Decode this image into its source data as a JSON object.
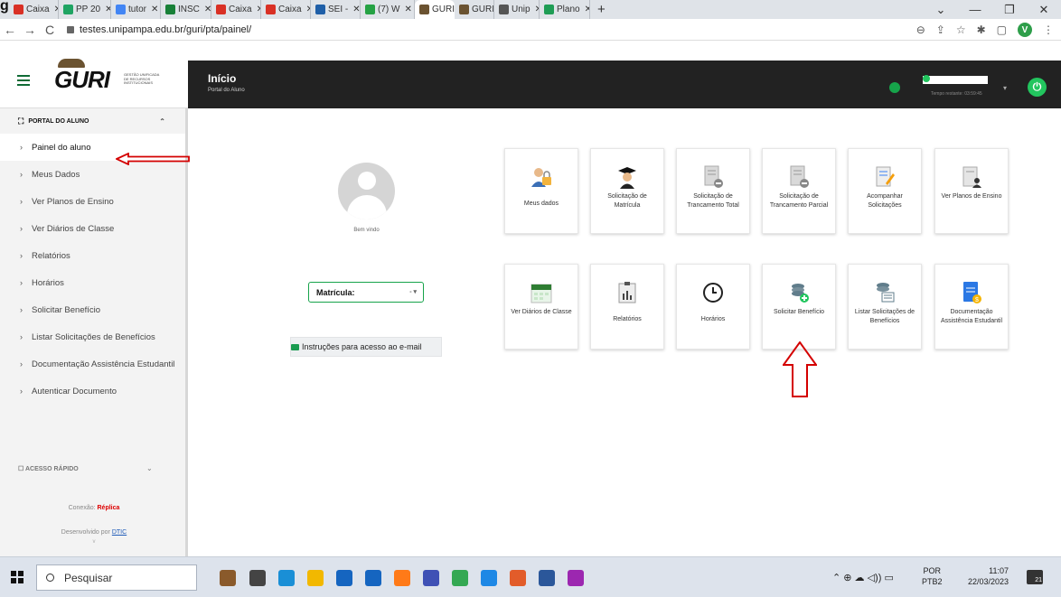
{
  "browser": {
    "tabs": [
      {
        "label": "Caixa",
        "icon": "gmail-icon",
        "color": "#d93025"
      },
      {
        "label": "PP 20",
        "icon": "drive-icon",
        "color": "#1fa463"
      },
      {
        "label": "tutor",
        "icon": "docs-icon",
        "color": "#4285f4"
      },
      {
        "label": "INSC",
        "icon": "sheets-icon",
        "color": "#188038"
      },
      {
        "label": "Caixa",
        "icon": "gmail-icon",
        "color": "#d93025"
      },
      {
        "label": "Caixa",
        "icon": "gmail-icon",
        "color": "#d93025"
      },
      {
        "label": "SEI -",
        "icon": "sei-icon",
        "color": "#1f5fa8"
      },
      {
        "label": "(7) W",
        "icon": "whatsapp-icon",
        "color": "#25a244"
      },
      {
        "label": "GURI",
        "icon": "guri-icon",
        "color": "#6b5331"
      },
      {
        "label": "GURI",
        "icon": "guri-icon",
        "color": "#6b5331"
      },
      {
        "label": "Unip",
        "icon": "globe-icon",
        "color": "#555555"
      },
      {
        "label": "Plano",
        "icon": "plano-icon",
        "color": "#1f9d55"
      }
    ],
    "active_tab": 8,
    "url": "testes.unipampa.edu.br/guri/pta/painel/",
    "profile_initial": "V"
  },
  "header": {
    "title": "Início",
    "subtitle": "Portal do Aluno",
    "timer": "Tempo restante: 03:59:45"
  },
  "logo": {
    "text": "GURI",
    "subtitle": "GESTÃO UNIFICADA DE RECURSOS INSTITUCIONAIS"
  },
  "sidebar": {
    "section_title": "PORTAL DO ALUNO",
    "items": [
      {
        "label": "Painel do aluno",
        "active": true
      },
      {
        "label": "Meus Dados"
      },
      {
        "label": "Ver Planos de Ensino"
      },
      {
        "label": "Ver Diários de Classe"
      },
      {
        "label": "Relatórios"
      },
      {
        "label": "Horários"
      },
      {
        "label": "Solicitar Benefício"
      },
      {
        "label": "Listar Solicitações de Benefícios"
      },
      {
        "label": "Documentação Assistência Estudantil"
      },
      {
        "label": "Autenticar Documento"
      }
    ],
    "quick_access": "ACESSO RÁPIDO",
    "connection_label": "Conexão:",
    "connection_value": "Réplica",
    "developed_by": "Desenvolvido por",
    "developer": "DTIC",
    "version": "v"
  },
  "main": {
    "welcome": "Bem vindo",
    "matricula_label": "Matrícula:",
    "email_button": "Instruções para acesso ao e-mail",
    "cards_row1": [
      {
        "label": "Meus dados",
        "icon": "user-lock-icon"
      },
      {
        "label": "Solicitação de Matrícula",
        "icon": "graduate-icon"
      },
      {
        "label": "Solicitação de Trancamento Total",
        "icon": "document-minus-icon"
      },
      {
        "label": "Solicitação de Trancamento Parcial",
        "icon": "document-minus-icon"
      },
      {
        "label": "Acompanhar Solicitações",
        "icon": "document-edit-icon"
      },
      {
        "label": "Ver Planos de Ensino",
        "icon": "document-user-icon"
      }
    ],
    "cards_row2": [
      {
        "label": "Ver Diários de Classe",
        "icon": "calendar-icon"
      },
      {
        "label": "Relatórios",
        "icon": "report-icon"
      },
      {
        "label": "Horários",
        "icon": "clock-icon"
      },
      {
        "label": "Solicitar Benefício",
        "icon": "coins-add-icon"
      },
      {
        "label": "Listar Solicitações de Benefícios",
        "icon": "coins-list-icon"
      },
      {
        "label": "Documentação Assistência Estudantil",
        "icon": "document-money-icon"
      }
    ]
  },
  "taskbar": {
    "search_placeholder": "Pesquisar",
    "lang_top": "POR",
    "lang_bottom": "PTB2",
    "time": "11:07",
    "date": "22/03/2023",
    "notifications": "21"
  },
  "colors": {
    "accent": "#16a34a",
    "topbar": "#222222",
    "annotation": "#d40000"
  }
}
